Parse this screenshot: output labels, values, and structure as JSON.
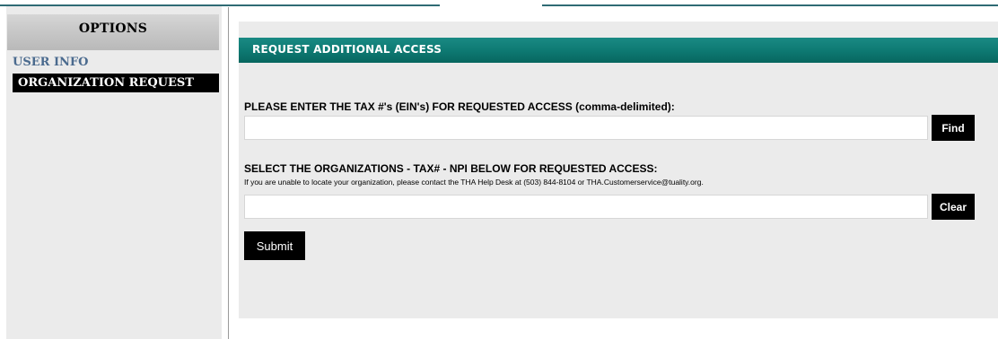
{
  "sidebar": {
    "header": "OPTIONS",
    "items": [
      {
        "label": "USER INFO"
      },
      {
        "label": "ORGANIZATION REQUEST"
      }
    ]
  },
  "panel": {
    "title": "REQUEST ADDITIONAL ACCESS",
    "tax_label": "PLEASE ENTER THE TAX #'s (EIN's) FOR REQUESTED ACCESS (comma-delimited):",
    "tax_input": {
      "value": "",
      "placeholder": ""
    },
    "find_label": "Find",
    "org_label": "SELECT THE ORGANIZATIONS - TAX# - NPI BELOW FOR REQUESTED ACCESS:",
    "help_note": "If you are unable to locate your organization, please contact the THA Help Desk at (503) 844-8104 or THA.Customerservice@tuality.org.",
    "org_input": {
      "value": "",
      "placeholder": ""
    },
    "clear_label": "Clear",
    "submit_label": "Submit"
  },
  "colors": {
    "header_teal": "#0e7a73",
    "link_blue": "#4a6a8e",
    "selected_bg": "#000000"
  }
}
